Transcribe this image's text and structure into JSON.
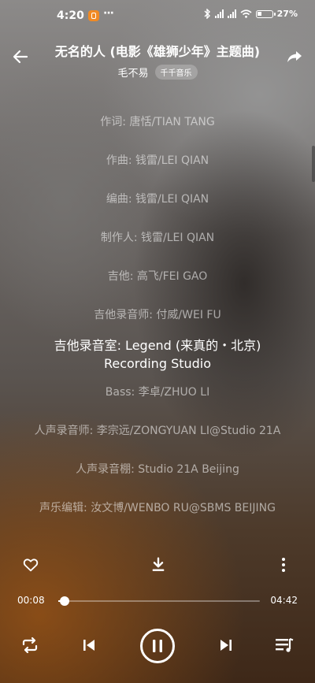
{
  "status": {
    "time": "4:20",
    "battery": "27%",
    "network_a": "4G",
    "network_b": "4G"
  },
  "header": {
    "title": "无名的人 (电影《雄狮少年》主题曲)",
    "artist": "毛不易",
    "label_badge": "千千音乐"
  },
  "lyrics": [
    "作词: 唐恬/TIAN TANG",
    "作曲: 钱雷/LEI QIAN",
    "编曲: 钱雷/LEI QIAN",
    "制作人: 钱雷/LEI QIAN",
    "吉他: 高飞/FEI GAO",
    "吉他录音师: 付威/WEI FU",
    "吉他录音室: Legend (来真的・北京)\nRecording Studio",
    "Bass: 李卓/ZHUO LI",
    "人声录音师: 李宗远/ZONGYUAN LI@Studio 21A",
    "人声录音棚: Studio 21A Beijing",
    "声乐编辑: 汝文博/WENBO RU@SBMS BEIJING"
  ],
  "player": {
    "current_time": "00:08",
    "total_time": "04:42",
    "progress_fraction": 0.03,
    "state": "playing"
  },
  "icons": {
    "back": "back-arrow-icon",
    "share": "share-icon",
    "like": "heart-icon",
    "download": "download-icon",
    "more": "more-vertical-icon",
    "repeat": "repeat-icon",
    "prev": "previous-icon",
    "pause": "pause-icon",
    "next": "next-icon",
    "playlist": "playlist-icon"
  }
}
